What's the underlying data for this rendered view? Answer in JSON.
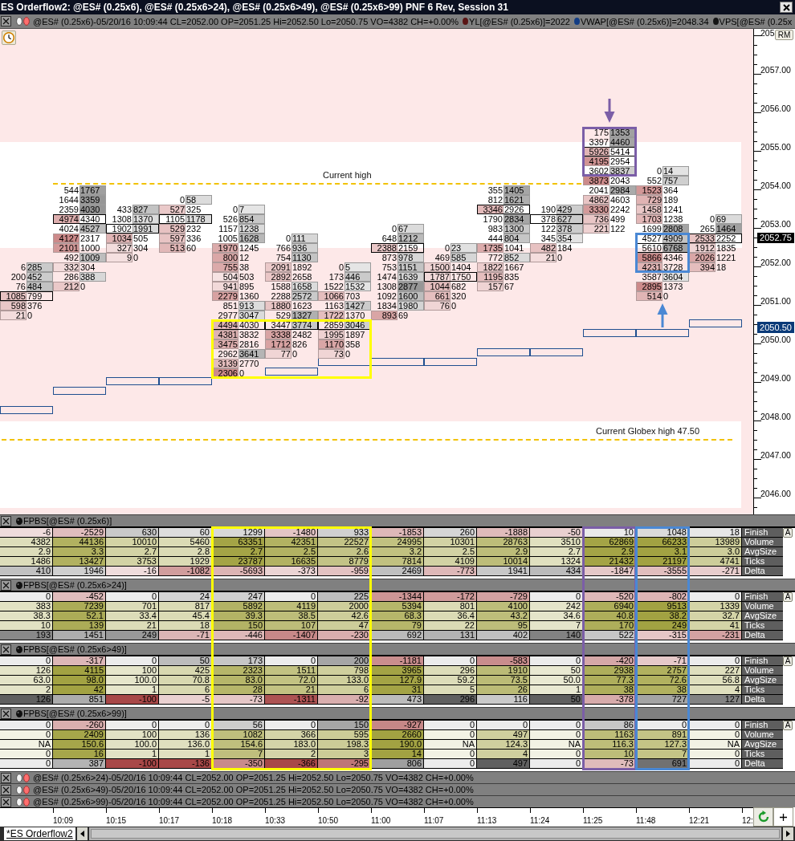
{
  "window": {
    "title": "ES Orderflow2: @ES# (0.25x6), @ES# (0.25x6>24), @ES# (0.25x6>49), @ES# (0.25x6>99) PNF 6 Rev, Session 31"
  },
  "chart": {
    "header": {
      "symbol_info": "@ES# (0.25x6)-05/20/16 10:09:44 CL=2052.00 OP=2051.25 Hi=2052.50 Lo=2050.75 VO=4382 CH=+0.00%",
      "indicators": [
        {
          "text": "YL[@ES# (0.25x6)]=2022",
          "color": "#5a1414"
        },
        {
          "text": "VWAP[@ES# (0.25x6)]=2048.34",
          "color": "#123c84"
        },
        {
          "text": "VPS[@ES# (0.25x",
          "color": "#141414"
        }
      ]
    },
    "reference_lines": [
      {
        "label": "Current high",
        "kind": "partial"
      },
      {
        "label": "Current Globex high 47.50",
        "kind": "full"
      }
    ],
    "columns": [
      {
        "rows": [
          {
            "bid": "6",
            "ask": "285",
            "outlined": false
          },
          {
            "bid": "200",
            "ask": "452",
            "outlined": false
          },
          {
            "bid": "76",
            "ask": "484",
            "outlined": false
          },
          {
            "bid": "1085",
            "ask": "799",
            "outlined": true
          },
          {
            "bid": "598",
            "ask": "376",
            "outlined": false
          },
          {
            "bid": "21",
            "ask": "0",
            "outlined": false
          }
        ]
      },
      {
        "rows": [
          {
            "bid": "544",
            "ask": "1767",
            "outlined": false
          },
          {
            "bid": "1644",
            "ask": "3359",
            "outlined": false
          },
          {
            "bid": "2359",
            "ask": "4030",
            "outlined": false
          },
          {
            "bid": "4974",
            "ask": "4340",
            "outlined": true
          },
          {
            "bid": "4024",
            "ask": "4527",
            "outlined": false
          },
          {
            "bid": "4127",
            "ask": "2317",
            "outlined": false
          },
          {
            "bid": "2101",
            "ask": "1000",
            "outlined": false
          },
          {
            "bid": "492",
            "ask": "1009",
            "outlined": false
          },
          {
            "bid": "332",
            "ask": "304",
            "outlined": false
          },
          {
            "bid": "286",
            "ask": "388",
            "outlined": false
          },
          {
            "bid": "212",
            "ask": "0",
            "outlined": false
          }
        ]
      },
      {
        "rows": [
          {
            "bid": "433",
            "ask": "827",
            "outlined": false
          },
          {
            "bid": "1308",
            "ask": "1370",
            "outlined": false
          },
          {
            "bid": "1902",
            "ask": "1991",
            "outlined": true
          },
          {
            "bid": "1034",
            "ask": "505",
            "outlined": false
          },
          {
            "bid": "327",
            "ask": "304",
            "outlined": false
          },
          {
            "bid": "9",
            "ask": "0",
            "outlined": false
          }
        ]
      },
      {
        "rows": [
          {
            "bid": "0",
            "ask": "58",
            "outlined": false
          },
          {
            "bid": "527",
            "ask": "325",
            "outlined": false
          },
          {
            "bid": "1105",
            "ask": "1178",
            "outlined": true
          },
          {
            "bid": "529",
            "ask": "232",
            "outlined": false
          },
          {
            "bid": "597",
            "ask": "336",
            "outlined": false
          },
          {
            "bid": "513",
            "ask": "60",
            "outlined": false
          }
        ]
      },
      {
        "box": {
          "color": "#ffff00",
          "kind": "plain"
        },
        "rows": [
          {
            "bid": "0",
            "ask": "7",
            "outlined": false
          },
          {
            "bid": "526",
            "ask": "854",
            "outlined": false
          },
          {
            "bid": "1157",
            "ask": "1238",
            "outlined": false
          },
          {
            "bid": "1005",
            "ask": "1628",
            "outlined": false
          },
          {
            "bid": "1970",
            "ask": "1245",
            "outlined": false
          },
          {
            "bid": "800",
            "ask": "12",
            "outlined": false
          },
          {
            "bid": "755",
            "ask": "38",
            "outlined": false
          },
          {
            "bid": "504",
            "ask": "503",
            "outlined": false
          },
          {
            "bid": "941",
            "ask": "895",
            "outlined": false
          },
          {
            "bid": "2279",
            "ask": "1360",
            "outlined": false
          },
          {
            "bid": "851",
            "ask": "913",
            "outlined": false
          },
          {
            "bid": "2977",
            "ask": "3047",
            "outlined": false
          },
          {
            "bid": "4494",
            "ask": "4030",
            "outlined": true
          },
          {
            "bid": "4381",
            "ask": "3832",
            "outlined": false
          },
          {
            "bid": "3475",
            "ask": "2816",
            "outlined": false
          },
          {
            "bid": "2962",
            "ask": "3641",
            "outlined": false
          },
          {
            "bid": "3139",
            "ask": "2770",
            "outlined": false
          },
          {
            "bid": "2306",
            "ask": "0",
            "outlined": false
          }
        ]
      },
      {
        "box": {
          "color": "#ffff00",
          "kind": "plain"
        },
        "rows": [
          {
            "bid": "0",
            "ask": "111",
            "outlined": false
          },
          {
            "bid": "766",
            "ask": "936",
            "outlined": false
          },
          {
            "bid": "754",
            "ask": "1130",
            "outlined": false
          },
          {
            "bid": "2091",
            "ask": "1892",
            "outlined": false
          },
          {
            "bid": "2892",
            "ask": "2658",
            "outlined": false
          },
          {
            "bid": "1588",
            "ask": "1658",
            "outlined": false
          },
          {
            "bid": "2288",
            "ask": "2572",
            "outlined": false
          },
          {
            "bid": "1880",
            "ask": "1623",
            "outlined": false
          },
          {
            "bid": "529",
            "ask": "1327",
            "outlined": false
          },
          {
            "bid": "3447",
            "ask": "3774",
            "outlined": true
          },
          {
            "bid": "3338",
            "ask": "2482",
            "outlined": false
          },
          {
            "bid": "1712",
            "ask": "826",
            "outlined": false
          },
          {
            "bid": "77",
            "ask": "0",
            "outlined": false
          }
        ]
      },
      {
        "box": {
          "color": "#ffff00",
          "kind": "plain"
        },
        "rows": [
          {
            "bid": "0",
            "ask": "5",
            "outlined": false
          },
          {
            "bid": "173",
            "ask": "446",
            "outlined": false
          },
          {
            "bid": "1522",
            "ask": "1532",
            "outlined": false
          },
          {
            "bid": "1066",
            "ask": "703",
            "outlined": false
          },
          {
            "bid": "1163",
            "ask": "1427",
            "outlined": false
          },
          {
            "bid": "1722",
            "ask": "1370",
            "outlined": false
          },
          {
            "bid": "2859",
            "ask": "3046",
            "outlined": true
          },
          {
            "bid": "1995",
            "ask": "1897",
            "outlined": false
          },
          {
            "bid": "1170",
            "ask": "358",
            "outlined": false
          },
          {
            "bid": "73",
            "ask": "0",
            "outlined": false
          }
        ]
      },
      {
        "rows": [
          {
            "bid": "0",
            "ask": "67",
            "outlined": false
          },
          {
            "bid": "648",
            "ask": "1212",
            "outlined": false
          },
          {
            "bid": "2388",
            "ask": "2159",
            "outlined": true
          },
          {
            "bid": "873",
            "ask": "978",
            "outlined": false
          },
          {
            "bid": "753",
            "ask": "1151",
            "outlined": false
          },
          {
            "bid": "1474",
            "ask": "1639",
            "outlined": false
          },
          {
            "bid": "1308",
            "ask": "2877",
            "outlined": false
          },
          {
            "bid": "1092",
            "ask": "1600",
            "outlined": false
          },
          {
            "bid": "1834",
            "ask": "1980",
            "outlined": false
          },
          {
            "bid": "893",
            "ask": "69",
            "outlined": false
          }
        ]
      },
      {
        "rows": [
          {
            "bid": "0",
            "ask": "23",
            "outlined": false
          },
          {
            "bid": "469",
            "ask": "585",
            "outlined": false
          },
          {
            "bid": "1500",
            "ask": "1404",
            "outlined": false
          },
          {
            "bid": "1787",
            "ask": "1750",
            "outlined": true
          },
          {
            "bid": "1044",
            "ask": "682",
            "outlined": false
          },
          {
            "bid": "661",
            "ask": "320",
            "outlined": false
          },
          {
            "bid": "76",
            "ask": "0",
            "outlined": false
          }
        ]
      },
      {
        "rows": [
          {
            "bid": "355",
            "ask": "1405",
            "outlined": false
          },
          {
            "bid": "812",
            "ask": "1621",
            "outlined": false
          },
          {
            "bid": "3346",
            "ask": "2926",
            "outlined": true
          },
          {
            "bid": "1790",
            "ask": "2834",
            "outlined": false
          },
          {
            "bid": "983",
            "ask": "1300",
            "outlined": false
          },
          {
            "bid": "444",
            "ask": "804",
            "outlined": false
          },
          {
            "bid": "1735",
            "ask": "1041",
            "outlined": false
          },
          {
            "bid": "772",
            "ask": "852",
            "outlined": false
          },
          {
            "bid": "1822",
            "ask": "1667",
            "outlined": false
          },
          {
            "bid": "1195",
            "ask": "835",
            "outlined": false
          },
          {
            "bid": "157",
            "ask": "67",
            "outlined": false
          }
        ]
      },
      {
        "rows": [
          {
            "bid": "190",
            "ask": "429",
            "outlined": false
          },
          {
            "bid": "378",
            "ask": "627",
            "outlined": true
          },
          {
            "bid": "122",
            "ask": "378",
            "outlined": false
          },
          {
            "bid": "345",
            "ask": "354",
            "outlined": false
          },
          {
            "bid": "482",
            "ask": "184",
            "outlined": false
          },
          {
            "bid": "21",
            "ask": "0",
            "outlined": false
          }
        ]
      },
      {
        "box": {
          "color": "#7b5ea7",
          "kind": "down"
        },
        "rows": [
          {
            "bid": "175",
            "ask": "1353",
            "outlined": false
          },
          {
            "bid": "3397",
            "ask": "4460",
            "outlined": false
          },
          {
            "bid": "5926",
            "ask": "5414",
            "outlined": true
          },
          {
            "bid": "4195",
            "ask": "2954",
            "outlined": false
          },
          {
            "bid": "3602",
            "ask": "3837",
            "outlined": false
          },
          {
            "bid": "3873",
            "ask": "2043",
            "outlined": false
          },
          {
            "bid": "2041",
            "ask": "2984",
            "outlined": false
          },
          {
            "bid": "4862",
            "ask": "4603",
            "outlined": false
          },
          {
            "bid": "3330",
            "ask": "2242",
            "outlined": false
          },
          {
            "bid": "736",
            "ask": "499",
            "outlined": false
          },
          {
            "bid": "221",
            "ask": "122",
            "outlined": false
          }
        ]
      },
      {
        "box": {
          "color": "#4a88d4",
          "kind": "up"
        },
        "rows": [
          {
            "bid": "0",
            "ask": "14",
            "outlined": false
          },
          {
            "bid": "552",
            "ask": "757",
            "outlined": false
          },
          {
            "bid": "1523",
            "ask": "364",
            "outlined": false
          },
          {
            "bid": "729",
            "ask": "189",
            "outlined": false
          },
          {
            "bid": "1458",
            "ask": "1241",
            "outlined": false
          },
          {
            "bid": "1703",
            "ask": "1238",
            "outlined": false
          },
          {
            "bid": "1699",
            "ask": "2808",
            "outlined": false
          },
          {
            "bid": "4527",
            "ask": "4909",
            "outlined": false
          },
          {
            "bid": "5610",
            "ask": "6768",
            "outlined": true
          },
          {
            "bid": "5866",
            "ask": "4346",
            "outlined": false
          },
          {
            "bid": "4231",
            "ask": "3728",
            "outlined": false
          },
          {
            "bid": "3587",
            "ask": "3604",
            "outlined": false
          },
          {
            "bid": "2895",
            "ask": "1373",
            "outlined": false
          },
          {
            "bid": "514",
            "ask": "0",
            "outlined": false
          }
        ]
      },
      {
        "rows": [
          {
            "bid": "0",
            "ask": "69",
            "outlined": false
          },
          {
            "bid": "265",
            "ask": "1464",
            "outlined": false
          },
          {
            "bid": "2533",
            "ask": "2252",
            "outlined": true
          },
          {
            "bid": "1912",
            "ask": "1835",
            "outlined": false
          },
          {
            "bid": "2026",
            "ask": "1221",
            "outlined": false
          },
          {
            "bid": "394",
            "ask": "18",
            "outlined": false
          }
        ]
      }
    ],
    "price_axis": {
      "labels": [
        "205",
        "2057.00",
        "2056.00",
        "2055.00",
        "2054.00",
        "2053.00",
        "2052.00",
        "2051.00",
        "2050.00",
        "2049.00",
        "2048.00",
        "2047.00",
        "2046.00"
      ],
      "last_price": "2052.75",
      "marker_price": "2050.50",
      "button": "RM"
    }
  },
  "panels": [
    {
      "title": "FPBS[@ES# (0.25x6)]",
      "scale_button": "A",
      "rows": [
        {
          "label": "Finish",
          "kind": "signed",
          "values": [
            "-6",
            "-2529",
            "630",
            "60",
            "1299",
            "-1480",
            "933",
            "-1853",
            "260",
            "-1888",
            "-50",
            "10",
            "1048",
            "18"
          ]
        },
        {
          "label": "Volume",
          "kind": "volume",
          "values": [
            "4382",
            "44136",
            "10010",
            "5460",
            "63351",
            "42351",
            "22527",
            "24995",
            "10301",
            "28763",
            "3510",
            "62869",
            "66233",
            "13989"
          ]
        },
        {
          "label": "AvgSize",
          "kind": "stat",
          "values": [
            "2.9",
            "3.3",
            "2.7",
            "2.8",
            "2.7",
            "2.5",
            "2.6",
            "3.2",
            "2.5",
            "2.9",
            "2.7",
            "2.9",
            "3.1",
            "3.0"
          ]
        },
        {
          "label": "Ticks",
          "kind": "stat",
          "values": [
            "1486",
            "13427",
            "3753",
            "1929",
            "23787",
            "16635",
            "8779",
            "7814",
            "4109",
            "10014",
            "1324",
            "21432",
            "21197",
            "4741"
          ]
        },
        {
          "label": "Delta",
          "kind": "signed",
          "values": [
            "410",
            "1946",
            "-16",
            "-1082",
            "-5693",
            "-373",
            "-959",
            "2469",
            "-773",
            "1941",
            "434",
            "-1847",
            "-3555",
            "-271"
          ]
        }
      ]
    },
    {
      "title": "FPBS[@ES# (0.25x6>24)]",
      "scale_button": "A",
      "rows": [
        {
          "label": "Finish",
          "kind": "signed",
          "values": [
            "0",
            "-452",
            "0",
            "24",
            "247",
            "0",
            "225",
            "-1344",
            "-172",
            "-729",
            "0",
            "-520",
            "-802",
            "0"
          ]
        },
        {
          "label": "Volume",
          "kind": "volume",
          "values": [
            "383",
            "7239",
            "701",
            "817",
            "5892",
            "4119",
            "2000",
            "5394",
            "801",
            "4100",
            "242",
            "6940",
            "9513",
            "1339"
          ]
        },
        {
          "label": "AvgSize",
          "kind": "stat",
          "values": [
            "38.3",
            "52.1",
            "33.4",
            "45.4",
            "39.3",
            "38.5",
            "42.6",
            "68.3",
            "36.4",
            "43.2",
            "34.6",
            "40.8",
            "38.2",
            "32.7"
          ]
        },
        {
          "label": "Ticks",
          "kind": "stat",
          "values": [
            "10",
            "139",
            "21",
            "18",
            "150",
            "107",
            "47",
            "79",
            "22",
            "95",
            "7",
            "170",
            "249",
            "41"
          ]
        },
        {
          "label": "Delta",
          "kind": "signed",
          "values": [
            "193",
            "1451",
            "249",
            "-71",
            "-446",
            "-1407",
            "-230",
            "692",
            "131",
            "402",
            "140",
            "522",
            "-315",
            "-231"
          ]
        }
      ]
    },
    {
      "title": "FPBS[@ES# (0.25x6>49)]",
      "scale_button": "A",
      "rows": [
        {
          "label": "Finish",
          "kind": "signed",
          "values": [
            "0",
            "-317",
            "0",
            "50",
            "173",
            "0",
            "200",
            "-1181",
            "0",
            "-583",
            "0",
            "-420",
            "-71",
            "0"
          ]
        },
        {
          "label": "Volume",
          "kind": "volume",
          "values": [
            "126",
            "4115",
            "100",
            "425",
            "2323",
            "1511",
            "798",
            "3965",
            "296",
            "1910",
            "50",
            "2938",
            "2757",
            "227"
          ]
        },
        {
          "label": "AvgSize",
          "kind": "stat",
          "values": [
            "63.0",
            "98.0",
            "100.0",
            "70.8",
            "83.0",
            "72.0",
            "133.0",
            "127.9",
            "59.2",
            "73.5",
            "50.0",
            "77.3",
            "72.6",
            "56.8"
          ]
        },
        {
          "label": "Ticks",
          "kind": "stat",
          "values": [
            "2",
            "42",
            "1",
            "6",
            "28",
            "21",
            "6",
            "31",
            "5",
            "26",
            "1",
            "38",
            "38",
            "4"
          ]
        },
        {
          "label": "Delta",
          "kind": "signed",
          "values": [
            "126",
            "851",
            "-100",
            "-5",
            "-73",
            "-1311",
            "-92",
            "473",
            "296",
            "116",
            "50",
            "-378",
            "727",
            "127"
          ]
        }
      ]
    },
    {
      "title": "FPBS[@ES# (0.25x6>99)]",
      "scale_button": "A",
      "rows": [
        {
          "label": "Finish",
          "kind": "signed",
          "values": [
            "0",
            "-260",
            "0",
            "0",
            "56",
            "0",
            "150",
            "-927",
            "0",
            "0",
            "0",
            "86",
            "0",
            "0"
          ]
        },
        {
          "label": "Volume",
          "kind": "volume",
          "values": [
            "0",
            "2409",
            "100",
            "136",
            "1082",
            "366",
            "595",
            "2660",
            "0",
            "497",
            "0",
            "1163",
            "891",
            "0"
          ]
        },
        {
          "label": "AvgSize",
          "kind": "stat",
          "values": [
            "NA",
            "150.6",
            "100.0",
            "136.0",
            "154.6",
            "183.0",
            "198.3",
            "190.0",
            "NA",
            "124.3",
            "NA",
            "116.3",
            "127.3",
            "NA"
          ]
        },
        {
          "label": "Ticks",
          "kind": "stat",
          "values": [
            "0",
            "16",
            "1",
            "1",
            "7",
            "2",
            "3",
            "14",
            "0",
            "4",
            "0",
            "10",
            "7",
            "0"
          ]
        },
        {
          "label": "Delta",
          "kind": "signed",
          "values": [
            "0",
            "387",
            "-100",
            "-136",
            "-350",
            "-366",
            "-295",
            "806",
            "0",
            "497",
            "0",
            "-73",
            "691",
            "0"
          ]
        }
      ]
    }
  ],
  "symbol_bars": [
    {
      "text": "@ES# (0.25x6>24)-05/20/16 10:09:44 CL=2052.00 OP=2051.25 Hi=2052.50 Lo=2050.75 VO=4382 CH=+0.00%"
    },
    {
      "text": "@ES# (0.25x6>49)-05/20/16 10:09:44 CL=2052.00 OP=2051.25 Hi=2052.50 Lo=2050.75 VO=4382 CH=+0.00%"
    },
    {
      "text": "@ES# (0.25x6>99)-05/20/16 10:09:44 CL=2052.00 OP=2051.25 Hi=2052.50 Lo=2050.75 VO=4382 CH=+0.00%"
    }
  ],
  "time_axis": {
    "labels": [
      "10:09",
      "10:15",
      "10:17",
      "10:18",
      "10:33",
      "10:50",
      "11:00",
      "11:07",
      "11:13",
      "11:24",
      "11:25",
      "11:48",
      "12:21",
      "12:"
    ]
  },
  "tabs": [
    {
      "label": "*ES Orderflow2",
      "selected": true
    }
  ]
}
